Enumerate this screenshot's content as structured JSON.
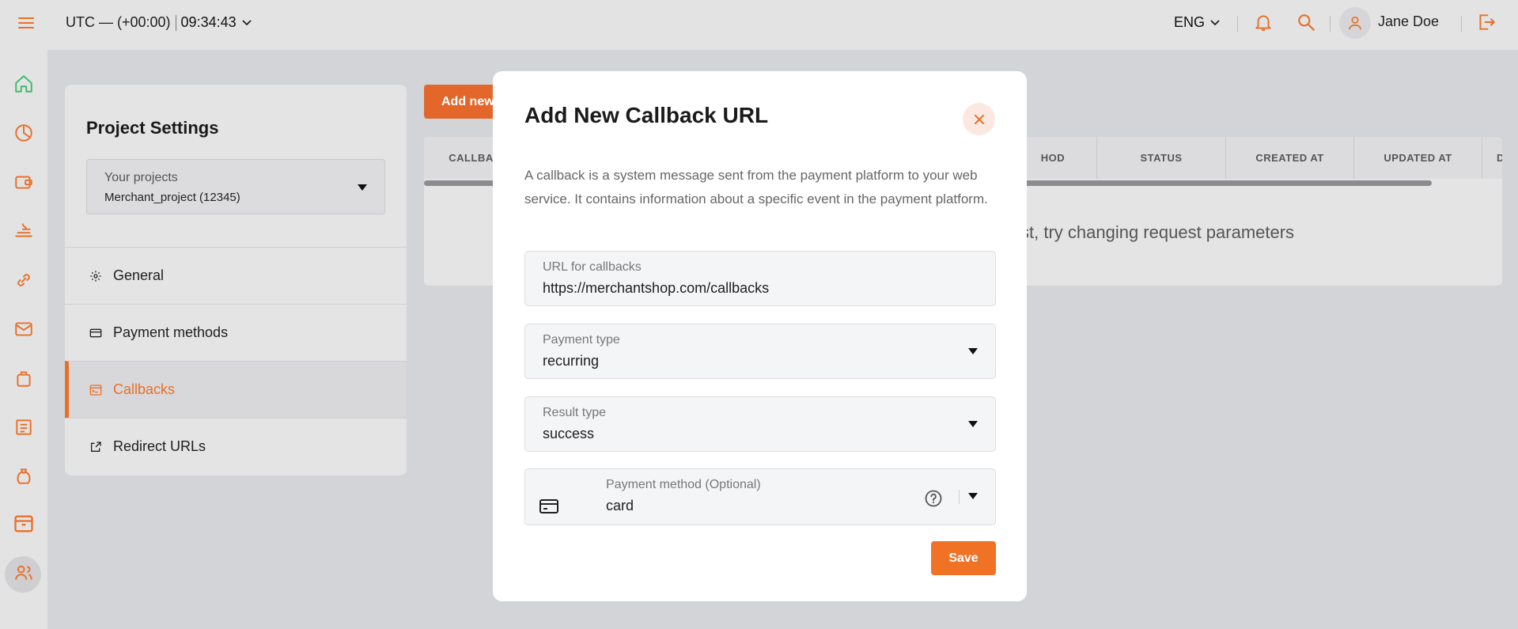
{
  "topbar": {
    "timezone": "UTC — (+00:00)",
    "time": "09:34:43",
    "language": "ENG",
    "user_name": "Jane Doe"
  },
  "rail": {
    "items": [
      "home-icon",
      "analytics-icon",
      "wallet-icon",
      "payouts-icon",
      "link-icon",
      "mail-icon",
      "bag-icon",
      "report-icon",
      "moneybag-icon",
      "projects-icon",
      "users-icon"
    ],
    "active_index": 9
  },
  "settings": {
    "title": "Project Settings",
    "project_select": {
      "label": "Your projects",
      "value": "Merchant_project (12345)"
    },
    "menu": [
      {
        "label": "General",
        "icon": "gear-icon"
      },
      {
        "label": "Payment methods",
        "icon": "card-icon"
      },
      {
        "label": "Callbacks",
        "icon": "terminal-icon"
      },
      {
        "label": "Redirect URLs",
        "icon": "external-link-icon"
      }
    ],
    "active_menu": "Callbacks"
  },
  "background": {
    "add_button": "Add new",
    "table_headers": [
      "CALLBA",
      "HOD",
      "STATUS",
      "CREATED AT",
      "UPDATED AT",
      "D"
    ],
    "empty_message": "st, try changing request parameters"
  },
  "modal": {
    "title": "Add New Callback URL",
    "description": "A callback is a system message sent from the payment platform to your web service. It contains information about a specific event in the payment platform.",
    "url_field": {
      "label": "URL for callbacks",
      "value": "https://merchantshop.com/callbacks"
    },
    "payment_type": {
      "label": "Payment type",
      "value": "recurring"
    },
    "result_type": {
      "label": "Result type",
      "value": "success"
    },
    "payment_method": {
      "label": "Payment method (Optional)",
      "value": "card"
    },
    "save_label": "Save"
  },
  "colors": {
    "accent": "#e8702a",
    "save_button": "#f07225",
    "home_icon": "#3dbb6b"
  }
}
